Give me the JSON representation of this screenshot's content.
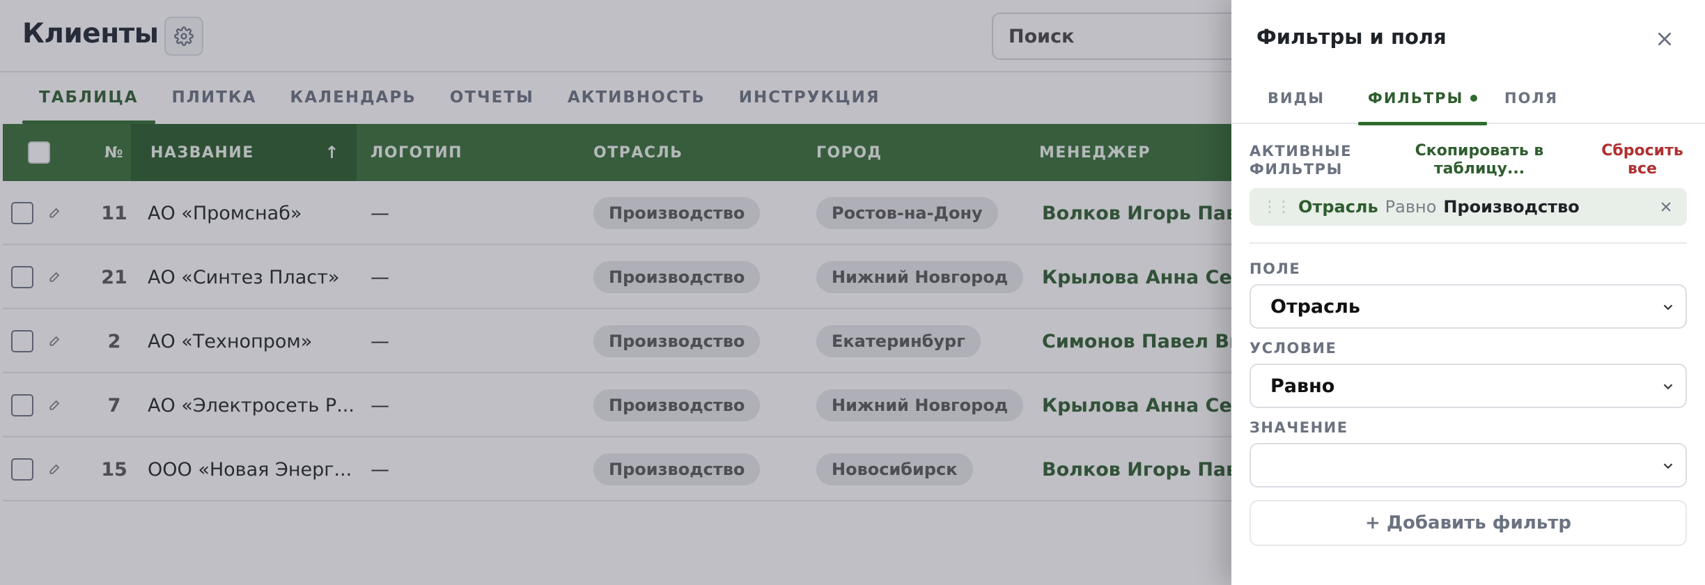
{
  "header": {
    "title": "Клиенты",
    "search_placeholder": "Поиск"
  },
  "tabs": [
    {
      "label": "ТАБЛИЦА",
      "active": true
    },
    {
      "label": "ПЛИТКА"
    },
    {
      "label": "КАЛЕНДАРЬ"
    },
    {
      "label": "ОТЧЕТЫ"
    },
    {
      "label": "АКТИВНОСТЬ"
    },
    {
      "label": "ИНСТРУКЦИЯ"
    }
  ],
  "table": {
    "columns": {
      "num": "№",
      "name": "НАЗВАНИЕ",
      "logo": "ЛОГОТИП",
      "industry": "ОТРАСЛЬ",
      "city": "ГОРОД",
      "manager": "МЕНЕДЖЕР"
    },
    "sort_indicator": "↑",
    "rows": [
      {
        "num": "11",
        "name": "АО «Промснаб»",
        "logo": "—",
        "industry": "Производство",
        "city": "Ростов-на-Дону",
        "manager": "Волков Игорь Пав..."
      },
      {
        "num": "21",
        "name": "АО «Синтез Пласт»",
        "logo": "—",
        "industry": "Производство",
        "city": "Нижний Новгород",
        "manager": "Крылова Анна Сер..."
      },
      {
        "num": "2",
        "name": "АО «Технопром»",
        "logo": "—",
        "industry": "Производство",
        "city": "Екатеринбург",
        "manager": "Симонов Павел Ви..."
      },
      {
        "num": "7",
        "name": "АО «Электросеть Р...",
        "logo": "—",
        "industry": "Производство",
        "city": "Нижний Новгород",
        "manager": "Крылова Анна Сер..."
      },
      {
        "num": "15",
        "name": "ООО «Новая Энерг...",
        "logo": "—",
        "industry": "Производство",
        "city": "Новосибирск",
        "manager": "Волков Игорь Пав..."
      }
    ]
  },
  "panel": {
    "title": "Фильтры и поля",
    "tabs": {
      "views": "ВИДЫ",
      "filters": "ФИЛЬТРЫ",
      "fields": "ПОЛЯ"
    },
    "active_filters_label": "АКТИВНЫЕ ФИЛЬТРЫ",
    "copy_link": "Скопировать в таблицу...",
    "reset_link": "Сбросить все",
    "chip": {
      "field": "Отрасль",
      "operator": "Равно",
      "value": "Производство"
    },
    "field_label": "ПОЛЕ",
    "field_value": "Отрасль",
    "condition_label": "УСЛОВИЕ",
    "condition_value": "Равно",
    "value_label": "ЗНАЧЕНИЕ",
    "value_value": "",
    "add_filter": "+ Добавить фильтр"
  },
  "colors": {
    "accent": "#356e35",
    "accent_dark": "#285a28",
    "danger": "#b03030"
  },
  "icons": [
    "gear-icon",
    "checkbox-icon",
    "edit-icon",
    "sort-arrow-up-icon",
    "close-icon",
    "drag-handle-icon",
    "chevron-down-icon"
  ]
}
